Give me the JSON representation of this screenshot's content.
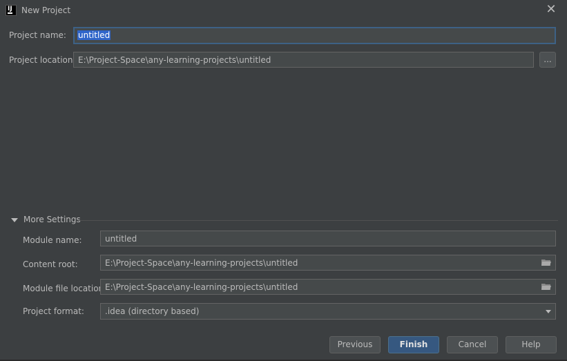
{
  "window": {
    "title": "New Project",
    "close_glyph": "✕"
  },
  "form": {
    "project_name_label": "Project name:",
    "project_name_value": "untitled",
    "project_location_label": "Project location:",
    "project_location_value": "E:\\Project-Space\\any-learning-projects\\untitled",
    "browse_label": "..."
  },
  "more_settings": {
    "header": "More Settings",
    "expanded": true,
    "module_name_label": "Module name:",
    "module_name_value": "untitled",
    "content_root_label": "Content root:",
    "content_root_value": "E:\\Project-Space\\any-learning-projects\\untitled",
    "module_file_location_label": "Module file location:",
    "module_file_location_value": "E:\\Project-Space\\any-learning-projects\\untitled",
    "project_format_label": "Project format:",
    "project_format_value": ".idea (directory based)"
  },
  "buttons": {
    "previous": "Previous",
    "finish": "Finish",
    "cancel": "Cancel",
    "help": "Help"
  },
  "colors": {
    "background": "#3c3f41",
    "field_bg": "#45494a",
    "accent": "#365880",
    "selection": "#2f65ca",
    "text": "#bbbbbb"
  },
  "icons": {
    "app": "intellij-idea-icon",
    "close": "close-icon",
    "folder": "folder-icon",
    "expand": "triangle-down-icon",
    "dropdown": "chevron-down-icon"
  }
}
